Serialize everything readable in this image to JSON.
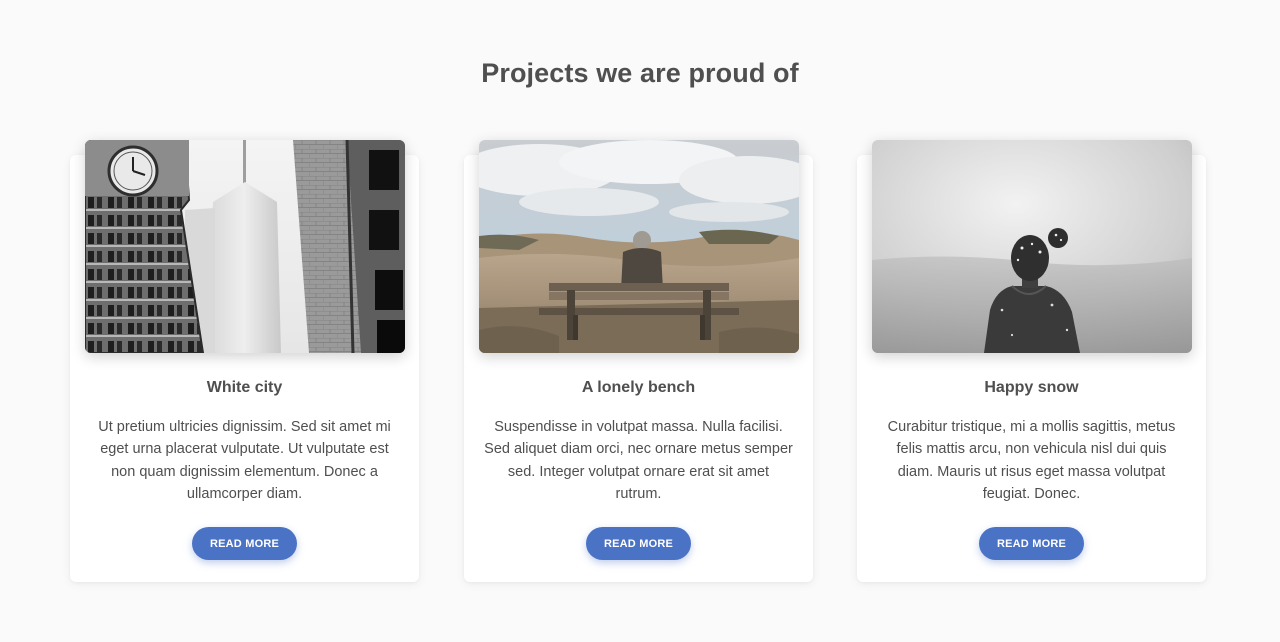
{
  "section": {
    "title": "Projects we are proud of"
  },
  "cards": [
    {
      "image": "black and white city buildings with clock tower",
      "title": "White city",
      "text": "Ut pretium ultricies dignissim. Sed sit amet mi eget urna placerat vulputate. Ut vulputate est non quam dignissim elementum. Donec a ullamcorper diam.",
      "button_label": "READ MORE"
    },
    {
      "image": "person sitting on a bench facing dunes under cloudy sky",
      "title": "A lonely bench",
      "text": "Suspendisse in volutpat massa. Nulla facilisi. Sed aliquet diam orci, nec ornare metus semper sed. Integer volutpat ornare erat sit amet rutrum.",
      "button_label": "READ MORE"
    },
    {
      "image": "black and white woman in snow seen from behind",
      "title": "Happy snow",
      "text": "Curabitur tristique, mi a mollis sagittis, metus felis mattis arcu, non vehicula nisl dui quis diam. Mauris ut risus eget massa volutpat feugiat. Donec.",
      "button_label": "READ MORE"
    }
  ],
  "colors": {
    "background": "#fafafa",
    "card": "#ffffff",
    "text": "#4f4f4f",
    "button": "#4a72c5",
    "button_text": "#ffffff"
  }
}
